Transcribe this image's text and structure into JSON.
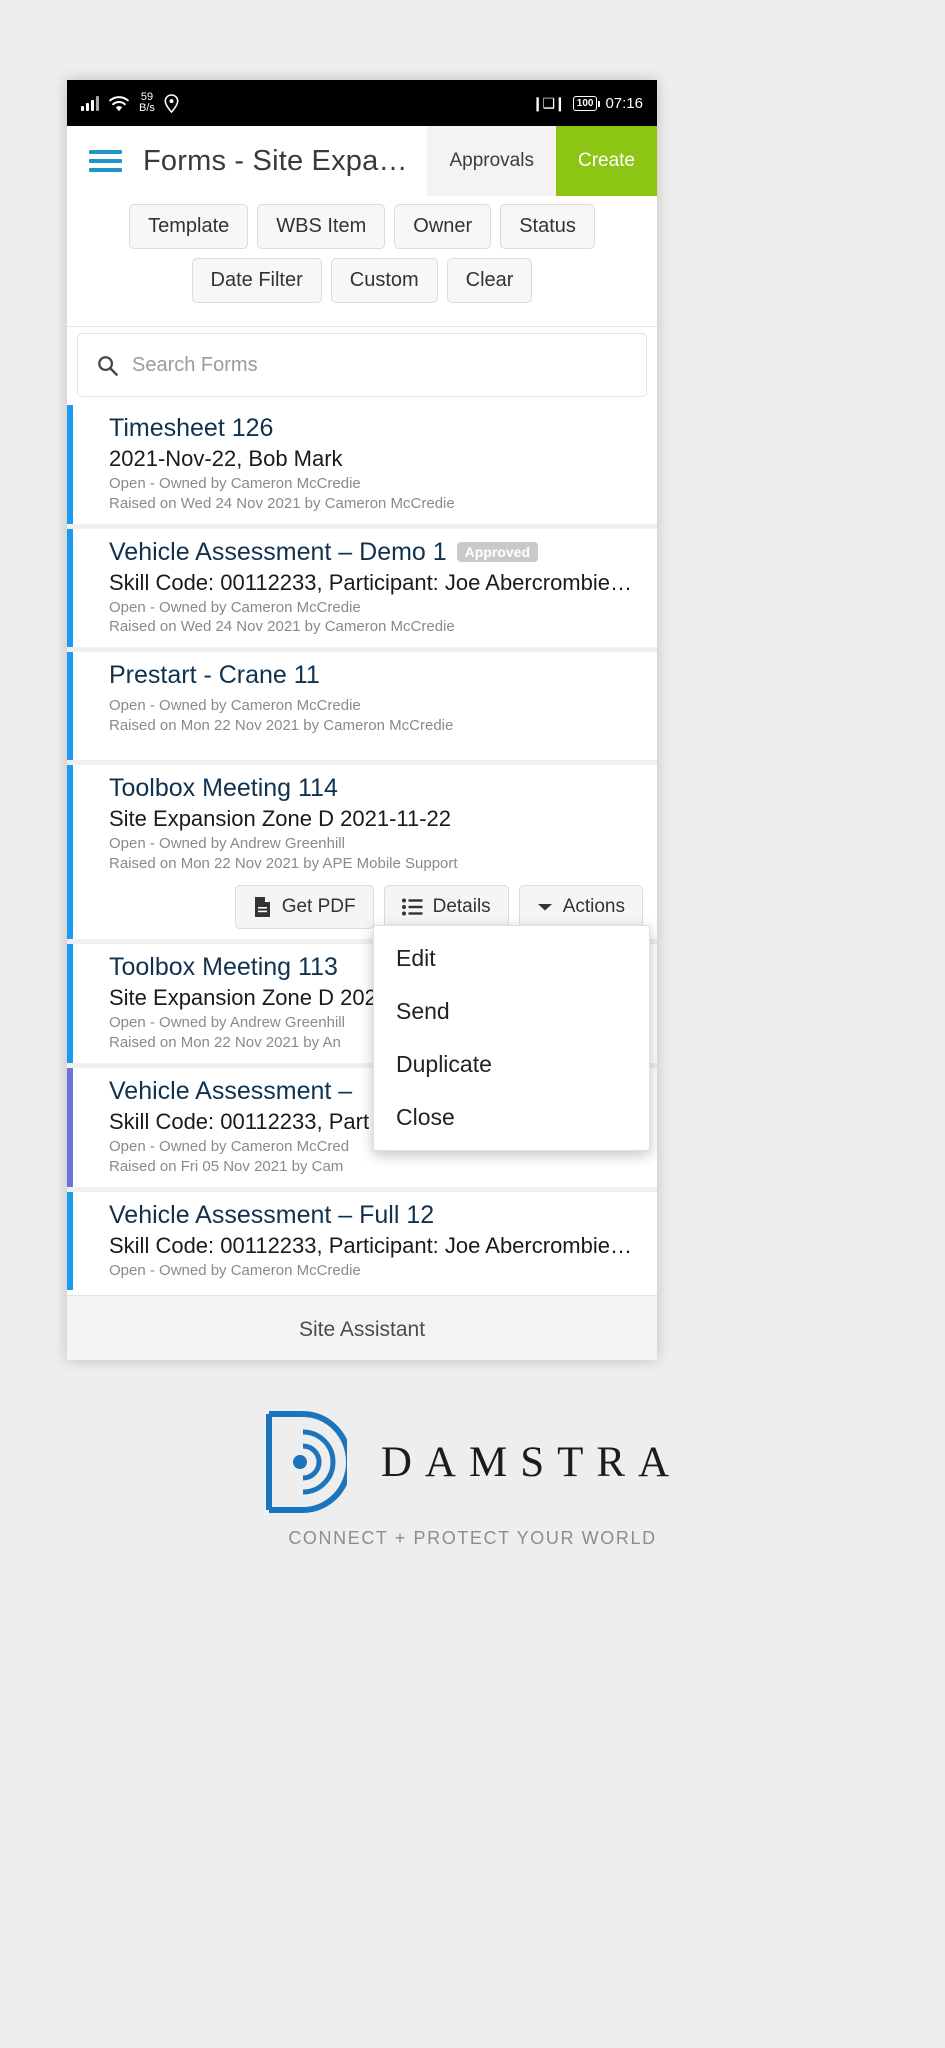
{
  "status_bar": {
    "network_speed_value": "59",
    "network_speed_unit": "B/s",
    "battery": "100",
    "time": "07:16",
    "icons": [
      "signal-icon",
      "wifi-icon",
      "location-icon",
      "vibrate-icon",
      "battery-icon"
    ]
  },
  "header": {
    "menu_icon": "hamburger-menu-icon",
    "title": "Forms - Site Expa…",
    "approvals_label": "Approvals",
    "create_label": "Create",
    "accent_create": "#8cc514",
    "accent_menu": "#2196c9"
  },
  "filters": {
    "row1": [
      "Template",
      "WBS Item",
      "Owner",
      "Status"
    ],
    "row2": [
      "Date Filter",
      "Custom",
      "Clear"
    ]
  },
  "search": {
    "placeholder": "Search Forms",
    "value": "",
    "icon": "search-icon"
  },
  "list": [
    {
      "title": "Timesheet 126",
      "badge": "",
      "subtitle": "2021-Nov-22, Bob Mark",
      "meta1": "Open - Owned by Cameron McCredie",
      "meta2": "Raised on Wed 24 Nov 2021 by Cameron McCredie",
      "accent": "#1b9bf0"
    },
    {
      "title": "Vehicle Assessment – Demo 1",
      "badge": "Approved",
      "subtitle": "Skill Code: 00112233, Participant: Joe Abercrombie…",
      "meta1": "Open - Owned by Cameron McCredie",
      "meta2": "Raised on Wed 24 Nov 2021 by Cameron McCredie",
      "accent": "#1b9bf0"
    },
    {
      "title": "Prestart - Crane 11",
      "badge": "",
      "subtitle": "",
      "meta1": "Open - Owned by Cameron McCredie",
      "meta2": "Raised on Mon 22 Nov 2021 by Cameron McCredie",
      "accent": "#1b9bf0"
    },
    {
      "title": "Toolbox Meeting 114",
      "badge": "",
      "subtitle": "Site Expansion Zone D 2021-11-22",
      "meta1": "Open - Owned by Andrew Greenhill",
      "meta2": "Raised on Mon 22 Nov 2021 by APE Mobile Support",
      "accent": "#1b9bf0",
      "actions": [
        {
          "label": "Get PDF",
          "icon": "pdf-document-icon"
        },
        {
          "label": "Details",
          "icon": "list-details-icon"
        },
        {
          "label": "Actions",
          "icon": "caret-down-icon"
        }
      ]
    },
    {
      "title": "Toolbox Meeting 113",
      "badge": "",
      "subtitle": "Site Expansion Zone D 202",
      "meta1": "Open - Owned by Andrew Greenhill",
      "meta2": "Raised on Mon 22 Nov 2021 by An",
      "accent": "#1b9bf0"
    },
    {
      "title": "Vehicle Assessment –",
      "badge": "",
      "subtitle": "Skill Code: 00112233, Part",
      "meta1": "Open - Owned by Cameron McCred",
      "meta2": "Raised on Fri 05 Nov 2021 by Cam",
      "accent": "#6d74d8"
    },
    {
      "title": "Vehicle Assessment – Full 12",
      "badge": "",
      "subtitle": "Skill Code: 00112233, Participant: Joe Abercrombie…",
      "meta1": "Open - Owned by Cameron McCredie",
      "meta2": "",
      "accent": "#1b9bf0"
    }
  ],
  "dropdown": {
    "items": [
      "Edit",
      "Send",
      "Duplicate",
      "Close"
    ]
  },
  "assistant": {
    "label": "Site Assistant"
  },
  "navbar": {
    "items": [
      "chevron-down-icon",
      "back-triangle-icon",
      "home-circle-icon",
      "recents-square-icon"
    ]
  },
  "footer": {
    "logo_icon": "damstra-logo-icon",
    "brand": "DAMSTRA",
    "tagline": "CONNECT + PROTECT YOUR WORLD",
    "brand_color": "#1c75bc"
  }
}
